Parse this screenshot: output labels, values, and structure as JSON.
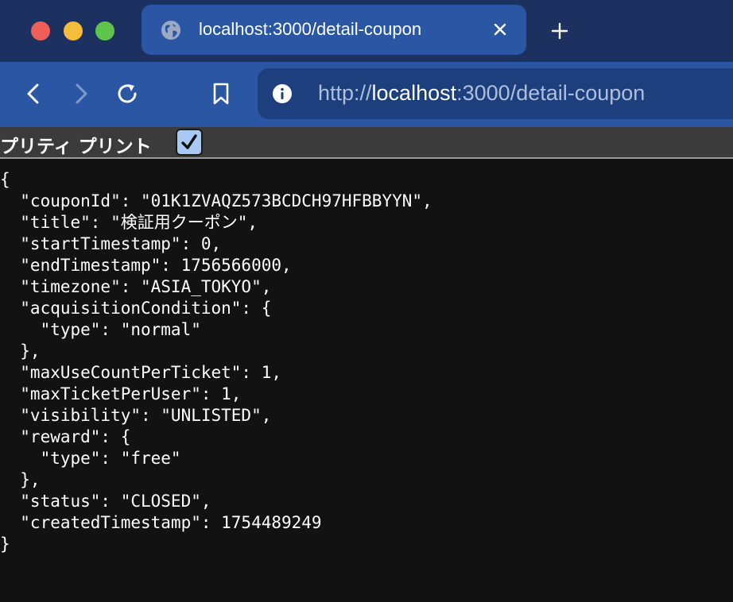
{
  "browser": {
    "tab": {
      "title": "localhost:3000/detail-coupon"
    },
    "url": {
      "scheme": "http://",
      "host": "localhost",
      "rest": ":3000/detail-coupon"
    }
  },
  "pretty_print": {
    "label": "プリティ プリント",
    "checked": true
  },
  "json": {
    "lines": [
      "{",
      "  \"couponId\": \"01K1ZVAQZ573BCDCH97HFBBYYN\",",
      "  \"title\": \"検証用クーポン\",",
      "  \"startTimestamp\": 0,",
      "  \"endTimestamp\": 1756566000,",
      "  \"timezone\": \"ASIA_TOKYO\",",
      "  \"acquisitionCondition\": {",
      "    \"type\": \"normal\"",
      "  },",
      "  \"maxUseCountPerTicket\": 1,",
      "  \"maxTicketPerUser\": 1,",
      "  \"visibility\": \"UNLISTED\",",
      "  \"reward\": {",
      "    \"type\": \"free\"",
      "  },",
      "  \"status\": \"CLOSED\",",
      "  \"createdTimestamp\": 1754489249",
      "}"
    ]
  },
  "icons": {
    "tab": "globe-icon",
    "close": "close-icon",
    "new_tab": "plus-icon",
    "back": "chevron-left-icon",
    "forward": "chevron-right-icon",
    "reload": "reload-icon",
    "bookmark": "bookmark-icon",
    "site_info": "info-icon",
    "checkbox": "checkmark-icon"
  },
  "colors": {
    "titlebar": "#1d3160",
    "tab_active": "#2a56a3",
    "toolbar": "#2a56a3",
    "urlbar": "#1e3f7e",
    "page_background": "#121212",
    "pretty_bar": "#3b3b3b",
    "checkbox": "#a9c8f2"
  }
}
